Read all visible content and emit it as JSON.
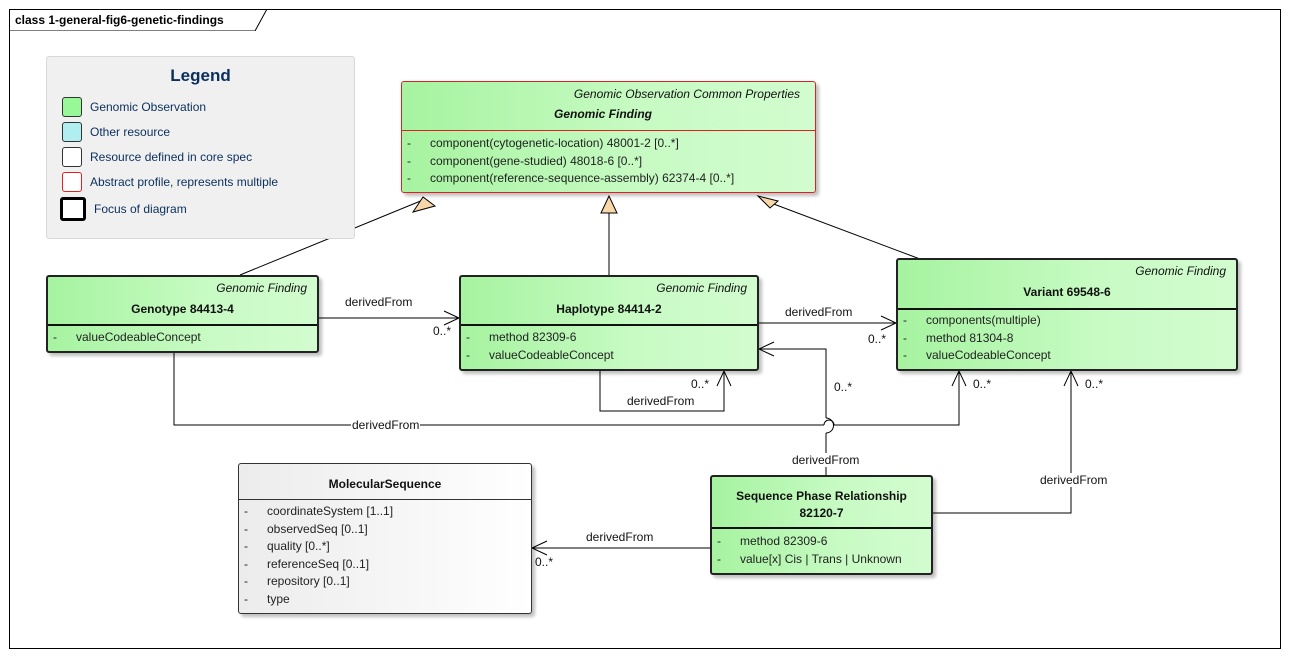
{
  "frame": {
    "title": "class 1-general-fig6-genetic-findings"
  },
  "legend": {
    "title": "Legend",
    "items": [
      {
        "label": "Genomic Observation",
        "fill": "#98f898",
        "border": "#333333"
      },
      {
        "label": "Other resource",
        "fill": "#b0eef0",
        "border": "#333333"
      },
      {
        "label": "Resource defined in core spec",
        "fill": "#ffffff",
        "border": "#333333"
      },
      {
        "label": "Abstract profile, represents multiple",
        "fill": "#ffffff",
        "border": "#e02020"
      },
      {
        "label": "Focus of diagram",
        "fill": "#ffffff",
        "border": "#000000"
      }
    ]
  },
  "classes": {
    "genomic_finding": {
      "stereotype": "Genomic Observation Common Properties",
      "name": "Genomic Finding",
      "attributes": [
        "component(cytogenetic-location) 48001-2 [0..*]",
        "component(gene-studied) 48018-6 [0..*]",
        "component(reference-sequence-assembly) 62374-4 [0..*]"
      ]
    },
    "genotype": {
      "stereotype": "Genomic Finding",
      "name": "Genotype  84413-4",
      "attributes": [
        "valueCodeableConcept"
      ]
    },
    "haplotype": {
      "stereotype": "Genomic Finding",
      "name": "Haplotype 84414-2",
      "attributes": [
        "method 82309-6",
        "valueCodeableConcept"
      ]
    },
    "variant": {
      "stereotype": "Genomic Finding",
      "name": "Variant 69548-6",
      "attributes": [
        "components(multiple)",
        "method 81304-8",
        "valueCodeableConcept"
      ]
    },
    "molecular_sequence": {
      "name": "MolecularSequence",
      "attributes": [
        "coordinateSystem [1..1]",
        "observedSeq [0..1]",
        "quality [0..*]",
        "referenceSeq [0..1]",
        "repository [0..1]",
        "type"
      ]
    },
    "sequence_phase_relationship": {
      "name_line1": "Sequence Phase Relationship",
      "name_line2": "82120-7",
      "attributes": [
        "method 82309-6",
        "value[x] Cis | Trans | Unknown"
      ]
    }
  },
  "connectors": {
    "genotype_to_haplotype": {
      "label": "derivedFrom",
      "multiplicity": "0..*"
    },
    "haplotype_to_variant": {
      "label": "derivedFrom",
      "multiplicity": "0..*"
    },
    "haplotype_self": {
      "label": "derivedFrom",
      "multiplicity": "0..*"
    },
    "genotype_to_variant": {
      "label": "derivedFrom",
      "multiplicity": "0..*"
    },
    "spr_to_haplotype": {
      "label": "derivedFrom",
      "multiplicity": "0..*"
    },
    "spr_to_variant": {
      "label": "derivedFrom",
      "multiplicity": "0..*"
    },
    "spr_to_molecular_sequence": {
      "label": "derivedFrom",
      "multiplicity": "0..*"
    }
  },
  "attr_bullet": "-"
}
